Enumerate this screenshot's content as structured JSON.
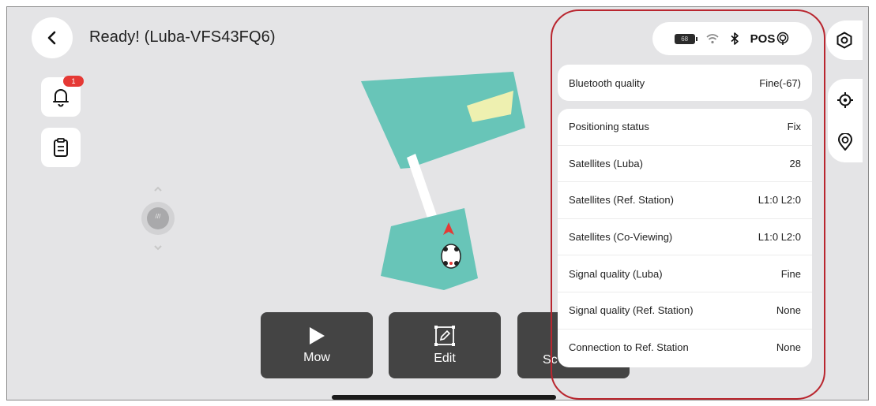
{
  "header": {
    "title": "Ready! (Luba-VFS43FQ6)"
  },
  "notifications": {
    "badge": "1"
  },
  "joystick": {
    "label": "///"
  },
  "status_bar": {
    "battery": "68",
    "pos_label": "POS"
  },
  "bluetooth": {
    "label": "Bluetooth quality",
    "value": "Fine(-67)"
  },
  "status_rows": [
    {
      "label": "Positioning status",
      "value": "Fix"
    },
    {
      "label": "Satellites (Luba)",
      "value": "28"
    },
    {
      "label": "Satellites (Ref. Station)",
      "value": "L1:0 L2:0"
    },
    {
      "label": "Satellites (Co-Viewing)",
      "value": "L1:0 L2:0"
    },
    {
      "label": "Signal quality (Luba)",
      "value": "Fine"
    },
    {
      "label": "Signal quality (Ref. Station)",
      "value": "None"
    },
    {
      "label": "Connection to Ref. Station",
      "value": "None"
    }
  ],
  "actions": {
    "mow": "Mow",
    "edit": "Edit",
    "schedule_partial": "Sc"
  },
  "colors": {
    "lawn": "#68c5b8",
    "path": "#ffffff",
    "no_go_zone": "#eef0b0",
    "action_button": "#444444",
    "annotation": "#b9262f"
  },
  "icons": {
    "back": "chevron-left-icon",
    "bell": "bell-icon",
    "report": "clipboard-icon",
    "settings": "gear-icon",
    "locate": "crosshair-icon",
    "rtk": "location-pin-icon",
    "wifi": "wifi-icon",
    "bluetooth": "bluetooth-icon",
    "play": "play-icon",
    "edit": "edit-box-icon"
  }
}
